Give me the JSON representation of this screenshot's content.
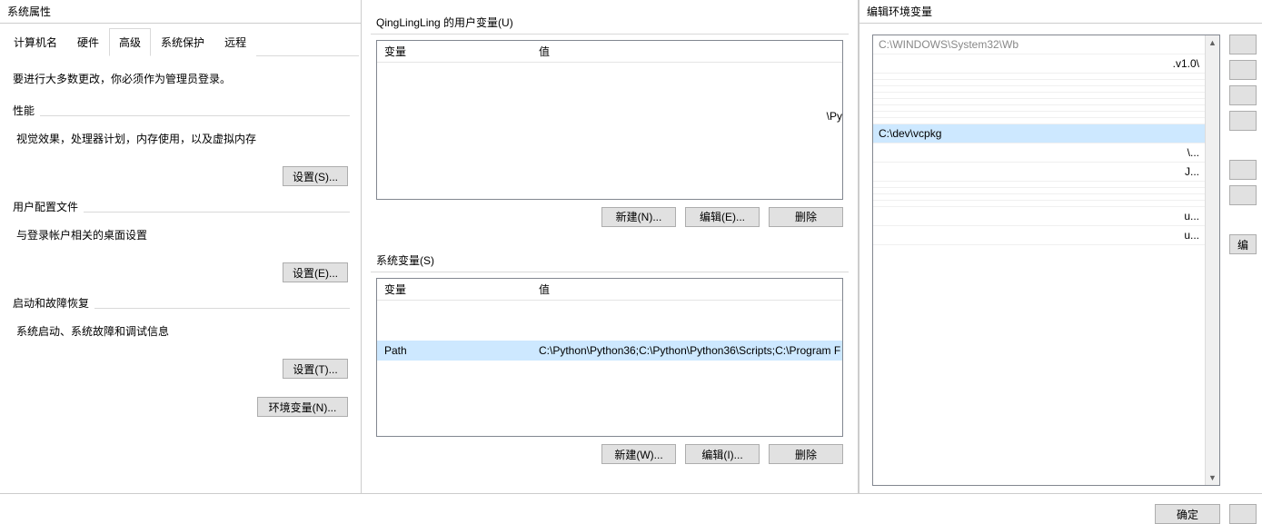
{
  "sysprops": {
    "title": "系统属性",
    "tabs": {
      "computer_name": "计算机名",
      "hardware": "硬件",
      "advanced": "高级",
      "system_protection": "系统保护",
      "remote": "远程"
    },
    "admin_note": "要进行大多数更改，你必须作为管理员登录。",
    "perf": {
      "header": "性能",
      "desc": "视觉效果，处理器计划，内存使用，以及虚拟内存",
      "button": "设置(S)..."
    },
    "userprofile": {
      "header": "用户配置文件",
      "desc": "与登录帐户相关的桌面设置",
      "button": "设置(E)..."
    },
    "startup": {
      "header": "启动和故障恢复",
      "desc": "系统启动、系统故障和调试信息",
      "button": "设置(T)..."
    },
    "envvar_button": "环境变量(N)..."
  },
  "env": {
    "user_group_label": "QingLingLing 的用户变量(U)",
    "col_var": "变量",
    "col_val": "值",
    "user_rows": [
      {
        "var": "",
        "val": "\\Py"
      }
    ],
    "user_buttons": {
      "new": "新建(N)...",
      "edit": "编辑(E)...",
      "delete": "删除"
    },
    "sys_group_label": "系统变量(S)",
    "sys_rows": [
      {
        "var": "",
        "val": ""
      },
      {
        "var": "",
        "val": ""
      },
      {
        "var": "Path",
        "val": "C:\\Python\\Python36;C:\\Python\\Python36\\Scripts;C:\\Program F"
      }
    ],
    "sys_buttons": {
      "new": "新建(W)...",
      "edit": "编辑(I)...",
      "delete": "删除"
    }
  },
  "edit": {
    "title": "编辑环境变量",
    "path_entries_top": "C:\\WINDOWS\\System32\\Wb",
    "path_entries_1": ".v1.0\\",
    "path_entries_mid": "C:\\dev\\vcpkg",
    "trailing_chars": [
      "\\...",
      "J..."
    ],
    "trailing_chars2": [
      "u...",
      "u..."
    ],
    "ok_button": "确定"
  }
}
